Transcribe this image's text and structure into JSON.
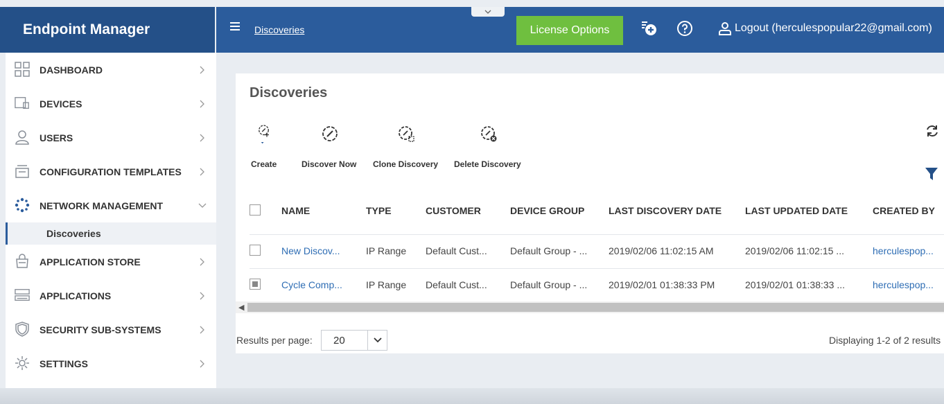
{
  "app": {
    "title": "Endpoint Manager"
  },
  "header": {
    "breadcrumb": "Discoveries",
    "license_button": "License Options",
    "logout": "Logout (herculespopular22@gmail.com)"
  },
  "sidebar": {
    "items": [
      {
        "label": "DASHBOARD",
        "icon": "dashboard-icon"
      },
      {
        "label": "DEVICES",
        "icon": "devices-icon"
      },
      {
        "label": "USERS",
        "icon": "user-icon"
      },
      {
        "label": "CONFIGURATION TEMPLATES",
        "icon": "templates-icon"
      },
      {
        "label": "NETWORK MANAGEMENT",
        "icon": "network-icon",
        "expanded": true
      },
      {
        "label": "APPLICATION STORE",
        "icon": "store-icon"
      },
      {
        "label": "APPLICATIONS",
        "icon": "applications-icon"
      },
      {
        "label": "SECURITY SUB-SYSTEMS",
        "icon": "shield-icon"
      },
      {
        "label": "SETTINGS",
        "icon": "gear-icon"
      }
    ],
    "sub_item": "Discoveries"
  },
  "main": {
    "title": "Discoveries",
    "toolbar": {
      "create": "Create",
      "discover_now": "Discover Now",
      "clone": "Clone Discovery",
      "delete": "Delete Discovery"
    },
    "table": {
      "headers": [
        "NAME",
        "TYPE",
        "CUSTOMER",
        "DEVICE GROUP",
        "LAST DISCOVERY DATE",
        "LAST UPDATED DATE",
        "CREATED BY"
      ],
      "rows": [
        {
          "checked": false,
          "cells": [
            "New Discov...",
            "IP Range",
            "Default Cust...",
            "Default Group - ...",
            "2019/02/06 11:02:15 AM",
            "2019/02/06 11:02:15 ...",
            "herculespop..."
          ]
        },
        {
          "checked": true,
          "cells": [
            "Cycle Comp...",
            "IP Range",
            "Default Cust...",
            "Default Group - ...",
            "2019/02/01 01:38:33 PM",
            "2019/02/01 01:38:33 ...",
            "herculespop..."
          ]
        }
      ]
    },
    "pagination": {
      "results_per_page_label": "Results per page:",
      "results_per_page_value": "20",
      "displaying": "Displaying 1-2 of 2 results"
    }
  },
  "colors": {
    "brand": "#245088",
    "header": "#2b5c9c",
    "license": "#6fbf3f",
    "link": "#2e6db4"
  }
}
